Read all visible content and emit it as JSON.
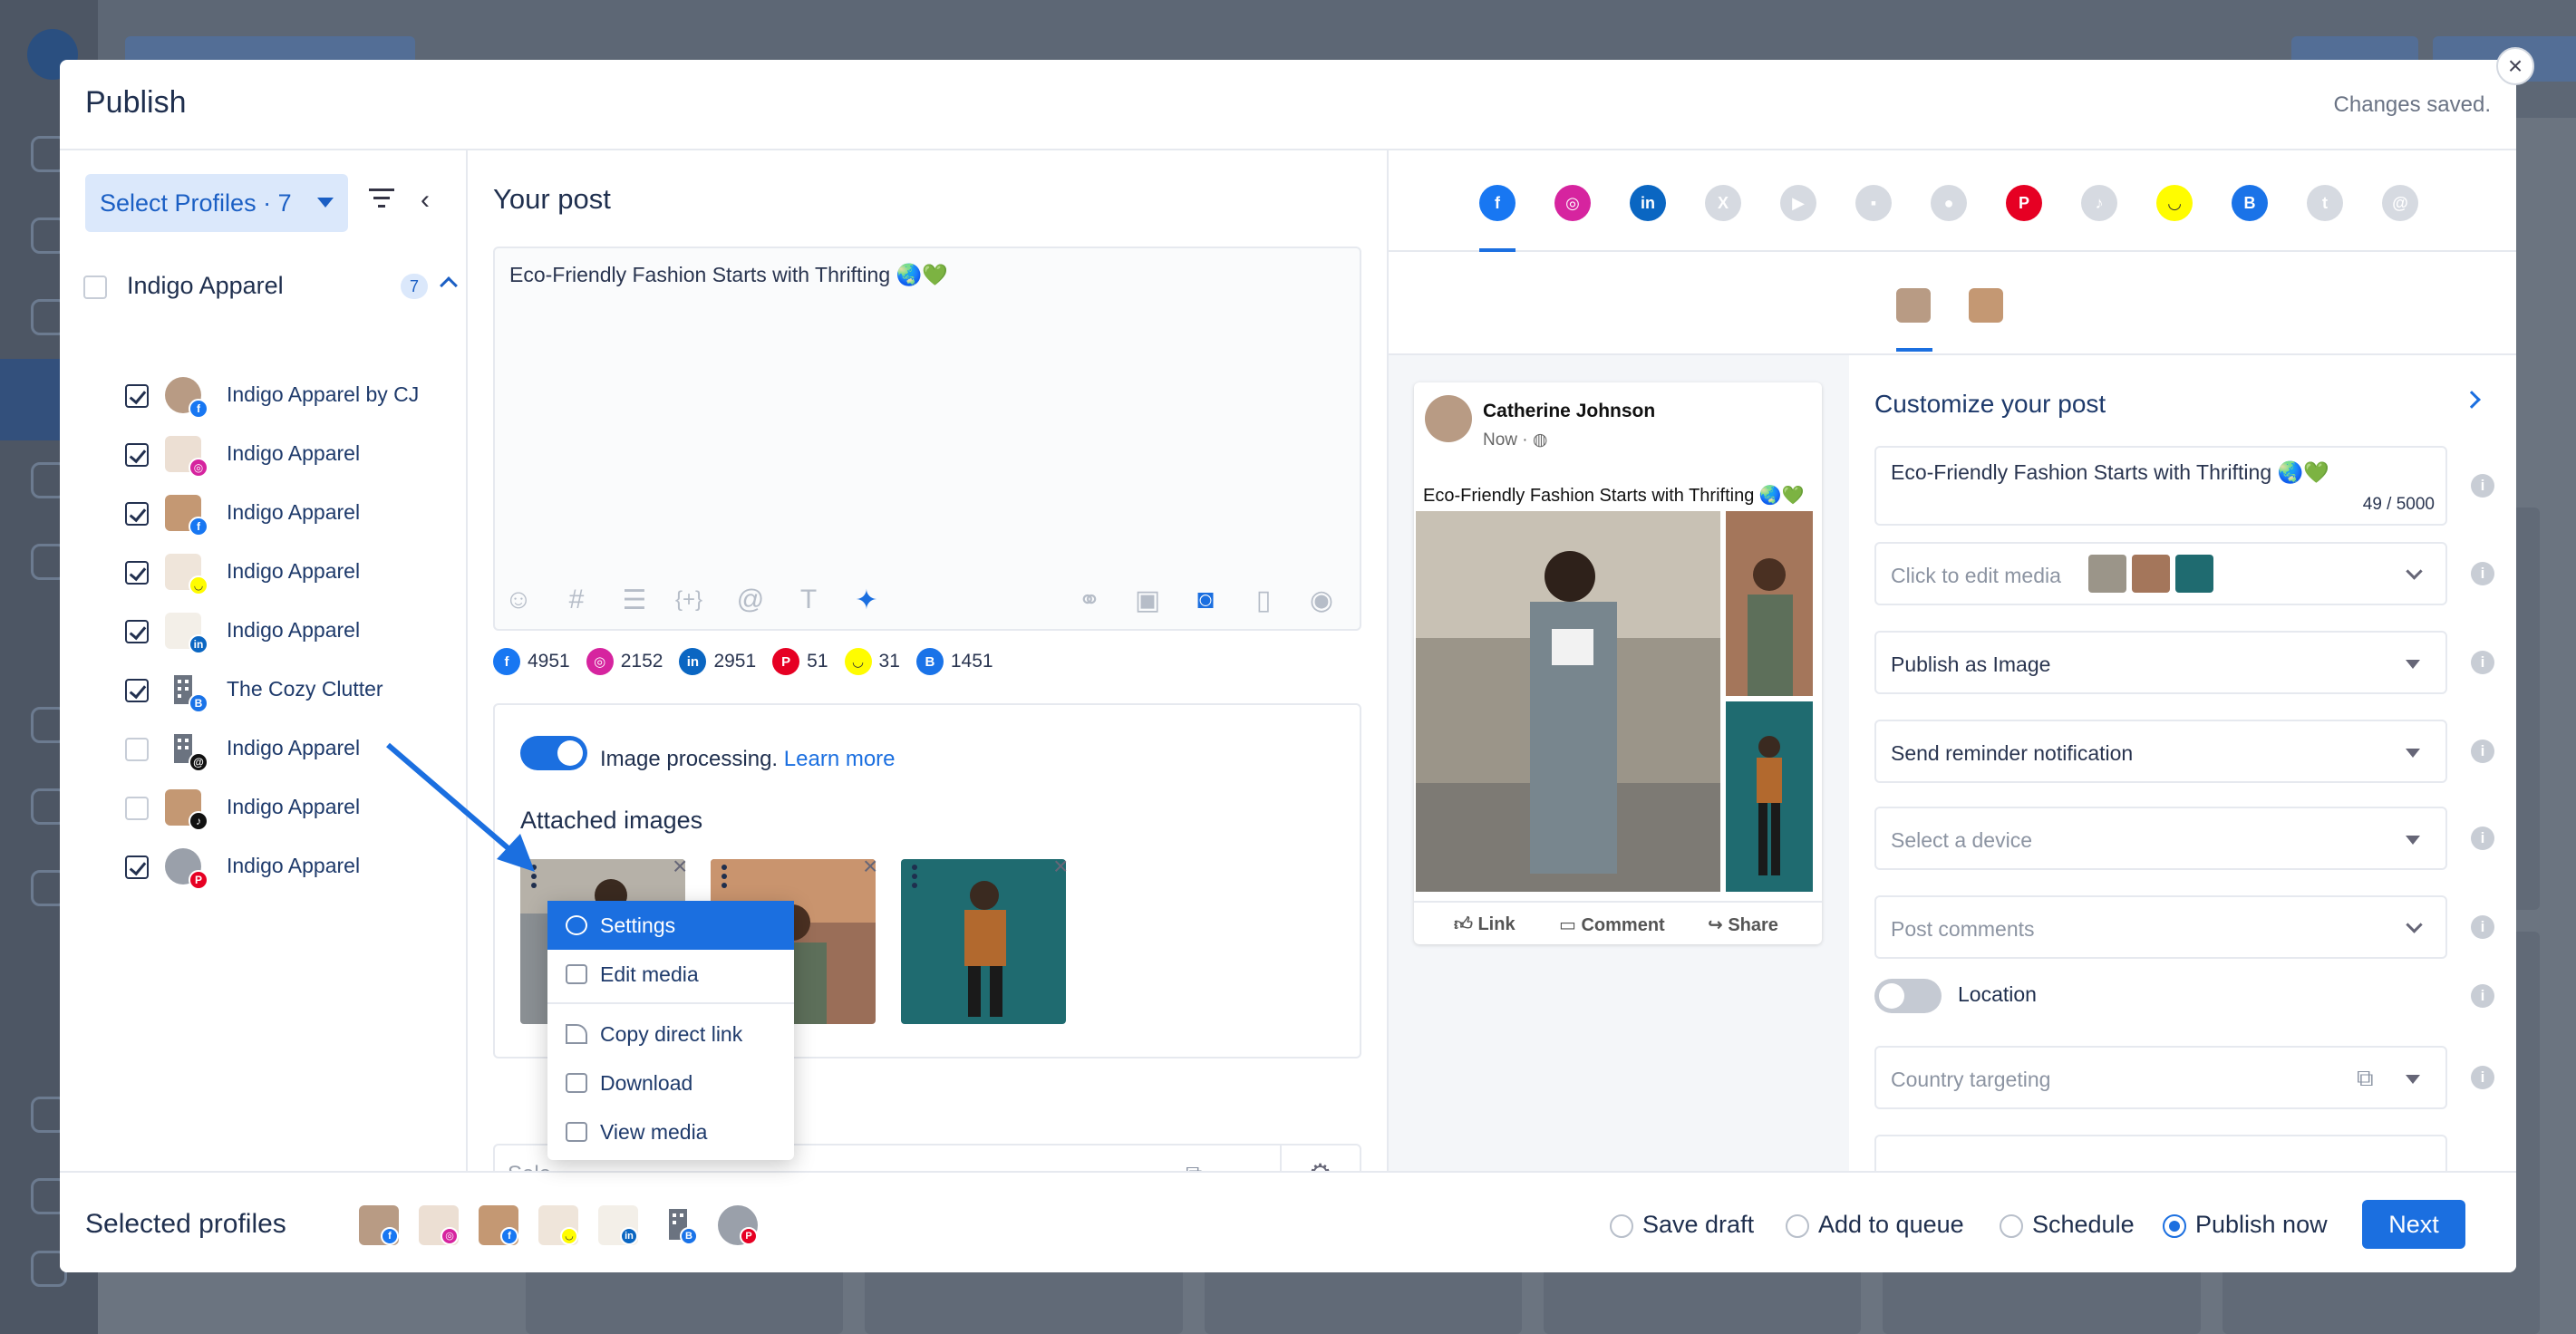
{
  "modal": {
    "title": "Publish",
    "status": "Changes saved."
  },
  "left": {
    "select_profiles_label": "Select Profiles · 7",
    "group": {
      "name": "Indigo Apparel",
      "count": "7"
    },
    "profiles": [
      {
        "name": "Indigo Apparel by CJ",
        "checked": true,
        "network": "facebook"
      },
      {
        "name": "Indigo Apparel",
        "checked": true,
        "network": "instagram"
      },
      {
        "name": "Indigo Apparel",
        "checked": true,
        "network": "facebook"
      },
      {
        "name": "Indigo Apparel",
        "checked": true,
        "network": "snapchat"
      },
      {
        "name": "Indigo Apparel",
        "checked": true,
        "network": "linkedin"
      },
      {
        "name": "The Cozy Clutter",
        "checked": true,
        "network": "google-business"
      },
      {
        "name": "Indigo Apparel",
        "checked": false,
        "network": "threads"
      },
      {
        "name": "Indigo Apparel",
        "checked": false,
        "network": "tiktok"
      },
      {
        "name": "Indigo Apparel",
        "checked": true,
        "network": "pinterest"
      }
    ]
  },
  "post": {
    "heading": "Your post",
    "text": "Eco-Friendly Fashion Starts with Thrifting 🌏💚",
    "counts": [
      {
        "network": "facebook",
        "value": "4951"
      },
      {
        "network": "instagram",
        "value": "2152"
      },
      {
        "network": "linkedin",
        "value": "2951"
      },
      {
        "network": "pinterest",
        "value": "51"
      },
      {
        "network": "snapchat",
        "value": "31"
      },
      {
        "network": "google-business",
        "value": "1451"
      }
    ],
    "image_processing_label": "Image processing.",
    "learn_more": "Learn more",
    "attached_images_title": "Attached images",
    "bottom_select_placeholder": "Sele"
  },
  "context_menu": {
    "items": [
      "Settings",
      "Edit media",
      "Copy direct link",
      "Download",
      "View media"
    ]
  },
  "preview": {
    "author": "Catherine Johnson",
    "time": "Now · ",
    "text": "Eco-Friendly Fashion Starts with Thrifting 🌏💚",
    "actions": [
      "Link",
      "Comment",
      "Share"
    ]
  },
  "customize": {
    "title": "Customize your post",
    "text": "Eco-Friendly Fashion Starts with Thrifting 🌏💚",
    "char_count": "49 / 5000",
    "edit_media": "Click to edit media",
    "publish_as": "Publish as Image",
    "reminder": "Send reminder notification",
    "device": "Select a device",
    "comments": "Post comments",
    "location": "Location",
    "country": "Country targeting"
  },
  "footer": {
    "selected_profiles_label": "Selected profiles",
    "options": [
      "Save draft",
      "Add to queue",
      "Schedule",
      "Publish now"
    ],
    "selected_option": "Publish now",
    "next_label": "Next"
  },
  "colors": {
    "accent": "#1b6fe0",
    "facebook": "#1877f2",
    "instagram": "#d6249f",
    "linkedin": "#0a66c2",
    "pinterest": "#e60023",
    "snapchat": "#fffc00",
    "google_business": "#1a73e8"
  }
}
